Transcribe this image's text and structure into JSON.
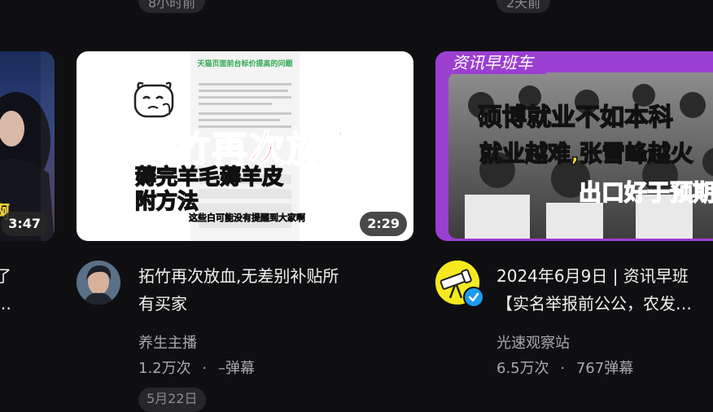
{
  "top_badges": {
    "left": "8小时前",
    "right": "2天前"
  },
  "card_left": {
    "duration": "3:47",
    "title_line1": "了",
    "title_line2": "…",
    "thumb_overlay_text": "啊"
  },
  "card_mid": {
    "duration": "2:29",
    "thumb_header": "天猫页面前台标价提高的问题",
    "thumb_big_text": "拓竹再次放血",
    "thumb_yellow_line1": "薅完羊毛薅羊皮",
    "thumb_yellow_line2": "附方法",
    "thumb_small_caption": "这些白可能没有提醒到大家啊",
    "title_line1": "拓竹再次放血,无差别补贴所",
    "title_line2": "有买家",
    "uploader": "养生主播",
    "views": "1.2万次",
    "danmaku": "–弹幕",
    "date": "5月22日"
  },
  "card_right": {
    "thumb_tag": "资讯早班车",
    "thumb_line1": "硕博就业不如本科",
    "thumb_line2": "就业越难,张雪峰越火",
    "thumb_line3": "出口好于预期",
    "title_line1": "2024年6月9日 | 资讯早班",
    "title_line2": "【实名举报前公公，农发…",
    "uploader": "光速观察站",
    "views": "6.5万次",
    "danmaku": "767弹幕"
  },
  "separator": "·",
  "colors": {
    "background": "#0f0f12",
    "accent_purple": "#9b3fd1",
    "verified_blue": "#1e9bf0"
  }
}
